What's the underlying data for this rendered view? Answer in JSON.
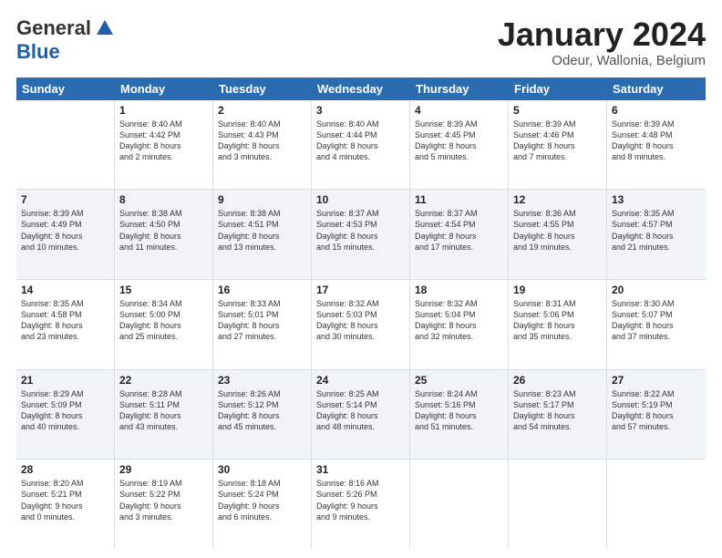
{
  "logo": {
    "general": "General",
    "blue": "Blue"
  },
  "title": "January 2024",
  "subtitle": "Odeur, Wallonia, Belgium",
  "header_days": [
    "Sunday",
    "Monday",
    "Tuesday",
    "Wednesday",
    "Thursday",
    "Friday",
    "Saturday"
  ],
  "weeks": [
    [
      {
        "day": "",
        "info": ""
      },
      {
        "day": "1",
        "info": "Sunrise: 8:40 AM\nSunset: 4:42 PM\nDaylight: 8 hours\nand 2 minutes."
      },
      {
        "day": "2",
        "info": "Sunrise: 8:40 AM\nSunset: 4:43 PM\nDaylight: 8 hours\nand 3 minutes."
      },
      {
        "day": "3",
        "info": "Sunrise: 8:40 AM\nSunset: 4:44 PM\nDaylight: 8 hours\nand 4 minutes."
      },
      {
        "day": "4",
        "info": "Sunrise: 8:39 AM\nSunset: 4:45 PM\nDaylight: 8 hours\nand 5 minutes."
      },
      {
        "day": "5",
        "info": "Sunrise: 8:39 AM\nSunset: 4:46 PM\nDaylight: 8 hours\nand 7 minutes."
      },
      {
        "day": "6",
        "info": "Sunrise: 8:39 AM\nSunset: 4:48 PM\nDaylight: 8 hours\nand 8 minutes."
      }
    ],
    [
      {
        "day": "7",
        "info": "Sunrise: 8:39 AM\nSunset: 4:49 PM\nDaylight: 8 hours\nand 10 minutes."
      },
      {
        "day": "8",
        "info": "Sunrise: 8:38 AM\nSunset: 4:50 PM\nDaylight: 8 hours\nand 11 minutes."
      },
      {
        "day": "9",
        "info": "Sunrise: 8:38 AM\nSunset: 4:51 PM\nDaylight: 8 hours\nand 13 minutes."
      },
      {
        "day": "10",
        "info": "Sunrise: 8:37 AM\nSunset: 4:53 PM\nDaylight: 8 hours\nand 15 minutes."
      },
      {
        "day": "11",
        "info": "Sunrise: 8:37 AM\nSunset: 4:54 PM\nDaylight: 8 hours\nand 17 minutes."
      },
      {
        "day": "12",
        "info": "Sunrise: 8:36 AM\nSunset: 4:55 PM\nDaylight: 8 hours\nand 19 minutes."
      },
      {
        "day": "13",
        "info": "Sunrise: 8:35 AM\nSunset: 4:57 PM\nDaylight: 8 hours\nand 21 minutes."
      }
    ],
    [
      {
        "day": "14",
        "info": "Sunrise: 8:35 AM\nSunset: 4:58 PM\nDaylight: 8 hours\nand 23 minutes."
      },
      {
        "day": "15",
        "info": "Sunrise: 8:34 AM\nSunset: 5:00 PM\nDaylight: 8 hours\nand 25 minutes."
      },
      {
        "day": "16",
        "info": "Sunrise: 8:33 AM\nSunset: 5:01 PM\nDaylight: 8 hours\nand 27 minutes."
      },
      {
        "day": "17",
        "info": "Sunrise: 8:32 AM\nSunset: 5:03 PM\nDaylight: 8 hours\nand 30 minutes."
      },
      {
        "day": "18",
        "info": "Sunrise: 8:32 AM\nSunset: 5:04 PM\nDaylight: 8 hours\nand 32 minutes."
      },
      {
        "day": "19",
        "info": "Sunrise: 8:31 AM\nSunset: 5:06 PM\nDaylight: 8 hours\nand 35 minutes."
      },
      {
        "day": "20",
        "info": "Sunrise: 8:30 AM\nSunset: 5:07 PM\nDaylight: 8 hours\nand 37 minutes."
      }
    ],
    [
      {
        "day": "21",
        "info": "Sunrise: 8:29 AM\nSunset: 5:09 PM\nDaylight: 8 hours\nand 40 minutes."
      },
      {
        "day": "22",
        "info": "Sunrise: 8:28 AM\nSunset: 5:11 PM\nDaylight: 8 hours\nand 43 minutes."
      },
      {
        "day": "23",
        "info": "Sunrise: 8:26 AM\nSunset: 5:12 PM\nDaylight: 8 hours\nand 45 minutes."
      },
      {
        "day": "24",
        "info": "Sunrise: 8:25 AM\nSunset: 5:14 PM\nDaylight: 8 hours\nand 48 minutes."
      },
      {
        "day": "25",
        "info": "Sunrise: 8:24 AM\nSunset: 5:16 PM\nDaylight: 8 hours\nand 51 minutes."
      },
      {
        "day": "26",
        "info": "Sunrise: 8:23 AM\nSunset: 5:17 PM\nDaylight: 8 hours\nand 54 minutes."
      },
      {
        "day": "27",
        "info": "Sunrise: 8:22 AM\nSunset: 5:19 PM\nDaylight: 8 hours\nand 57 minutes."
      }
    ],
    [
      {
        "day": "28",
        "info": "Sunrise: 8:20 AM\nSunset: 5:21 PM\nDaylight: 9 hours\nand 0 minutes."
      },
      {
        "day": "29",
        "info": "Sunrise: 8:19 AM\nSunset: 5:22 PM\nDaylight: 9 hours\nand 3 minutes."
      },
      {
        "day": "30",
        "info": "Sunrise: 8:18 AM\nSunset: 5:24 PM\nDaylight: 9 hours\nand 6 minutes."
      },
      {
        "day": "31",
        "info": "Sunrise: 8:16 AM\nSunset: 5:26 PM\nDaylight: 9 hours\nand 9 minutes."
      },
      {
        "day": "",
        "info": ""
      },
      {
        "day": "",
        "info": ""
      },
      {
        "day": "",
        "info": ""
      }
    ]
  ]
}
